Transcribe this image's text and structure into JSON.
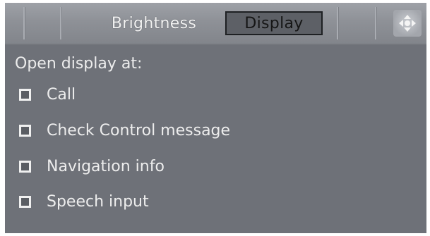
{
  "tabs": [
    {
      "label": "Brightness",
      "selected": false
    },
    {
      "label": "Display",
      "selected": true
    }
  ],
  "nav_button": {
    "icon": "scroll-arrows-icon"
  },
  "section": {
    "heading": "Open display at:",
    "options": [
      {
        "label": "Call",
        "checked": false
      },
      {
        "label": "Check Control message",
        "checked": false
      },
      {
        "label": "Navigation info",
        "checked": false
      },
      {
        "label": "Speech input",
        "checked": false
      }
    ]
  },
  "colors": {
    "background": "#6e7178",
    "tabbar": "#8e9197",
    "selected_tab": "#5d6066",
    "text": "#eeeeee"
  }
}
